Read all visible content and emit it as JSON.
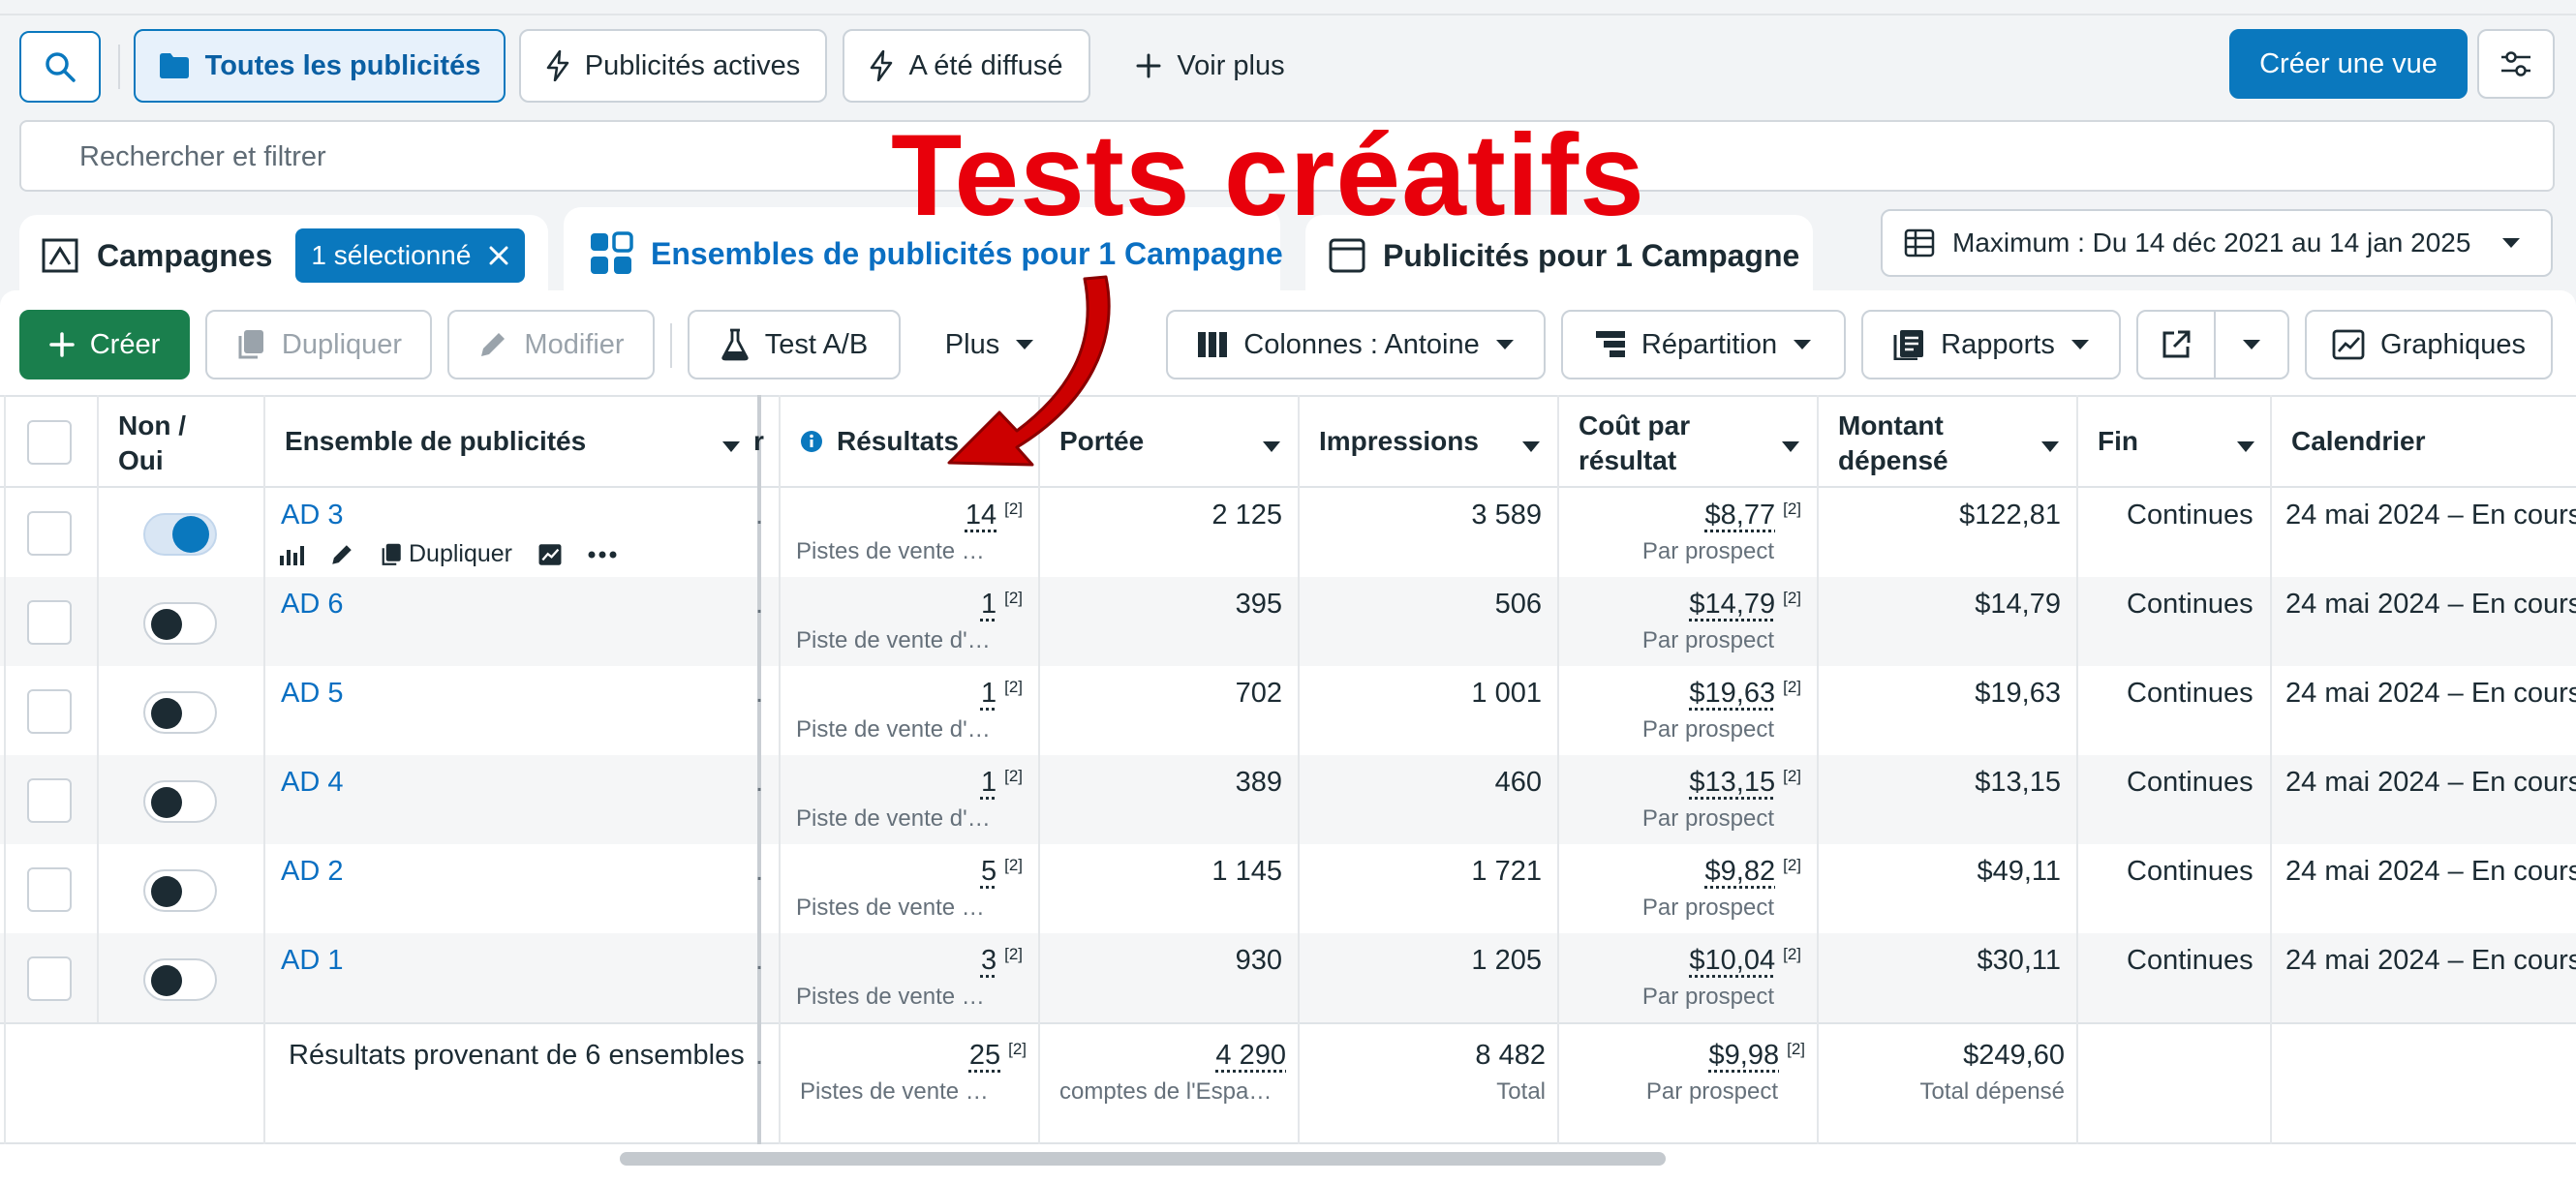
{
  "toolbar": {
    "tabs": [
      {
        "label": "Toutes les publicités",
        "icon": "folder-icon"
      },
      {
        "label": "Publicités actives",
        "icon": "bolt-icon"
      },
      {
        "label": "A été diffusé",
        "icon": "bolt-icon"
      },
      {
        "label": "Voir plus",
        "icon": "plus-icon"
      }
    ],
    "create_view": "Créer une vue"
  },
  "search": {
    "placeholder": "Rechercher et filtrer"
  },
  "overlay": {
    "title": "Tests créatifs"
  },
  "level_tabs": {
    "campaigns": "Campagnes",
    "campaigns_badge": "1 sélectionné",
    "adsets": "Ensembles de publicités pour 1 Campagne",
    "ads": "Publicités pour 1 Campagne"
  },
  "date_range": "Maximum : Du 14 déc 2021 au 14 jan 2025",
  "actions": {
    "create": "Créer",
    "duplicate": "Dupliquer",
    "edit": "Modifier",
    "abtest": "Test A/B",
    "more": "Plus",
    "columns": "Colonnes : Antoine",
    "breakdown": "Répartition",
    "reports": "Rapports",
    "charts": "Graphiques"
  },
  "table": {
    "headers": {
      "toggle": "Non / Oui",
      "adset": "Ensemble de publicités",
      "cut": "r",
      "results": "Résultats",
      "reach": "Portée",
      "impressions": "Impressions",
      "cpr": "Coût par résultat",
      "spent": "Montant dépensé",
      "end": "Fin",
      "schedule": "Calendrier"
    },
    "hover_actions": {
      "duplicate": "Dupliquer"
    },
    "rows": [
      {
        "name": "AD 3",
        "on": true,
        "results": "14",
        "results_sub": "Pistes de vente …",
        "reach": "2 125",
        "impressions": "3 589",
        "cpr": "$8,77",
        "cpr_sub": "Par prospect",
        "spent": "$122,81",
        "end": "Continues",
        "schedule": "24 mai 2024 – En cours"
      },
      {
        "name": "AD 6",
        "on": false,
        "results": "1",
        "results_sub": "Piste de vente d'…",
        "reach": "395",
        "impressions": "506",
        "cpr": "$14,79",
        "cpr_sub": "Par prospect",
        "spent": "$14,79",
        "end": "Continues",
        "schedule": "24 mai 2024 – En cours"
      },
      {
        "name": "AD 5",
        "on": false,
        "results": "1",
        "results_sub": "Piste de vente d'…",
        "reach": "702",
        "impressions": "1 001",
        "cpr": "$19,63",
        "cpr_sub": "Par prospect",
        "spent": "$19,63",
        "end": "Continues",
        "schedule": "24 mai 2024 – En cours"
      },
      {
        "name": "AD 4",
        "on": false,
        "results": "1",
        "results_sub": "Piste de vente d'…",
        "reach": "389",
        "impressions": "460",
        "cpr": "$13,15",
        "cpr_sub": "Par prospect",
        "spent": "$13,15",
        "end": "Continues",
        "schedule": "24 mai 2024 – En cours"
      },
      {
        "name": "AD 2",
        "on": false,
        "results": "5",
        "results_sub": "Pistes de vente …",
        "reach": "1 145",
        "impressions": "1 721",
        "cpr": "$9,82",
        "cpr_sub": "Par prospect",
        "spent": "$49,11",
        "end": "Continues",
        "schedule": "24 mai 2024 – En cours"
      },
      {
        "name": "AD 1",
        "on": false,
        "results": "3",
        "results_sub": "Pistes de vente …",
        "reach": "930",
        "impressions": "1 205",
        "cpr": "$10,04",
        "cpr_sub": "Par prospect",
        "spent": "$30,11",
        "end": "Continues",
        "schedule": "24 mai 2024 – En cours"
      }
    ],
    "refnote": "[2]",
    "totals": {
      "label": "Résultats provenant de 6 ensembles",
      "results": "25",
      "results_sub": "Pistes de vente …",
      "reach": "4 290",
      "reach_sub": "comptes de l'Espa…",
      "impressions": "8 482",
      "impressions_sub": "Total",
      "cpr": "$9,98",
      "cpr_sub": "Par prospect",
      "spent": "$249,60",
      "spent_sub": "Total dépensé"
    }
  },
  "colors": {
    "accent": "#0a78be",
    "create": "#1a7f4d",
    "annotation": "#e8000b"
  }
}
